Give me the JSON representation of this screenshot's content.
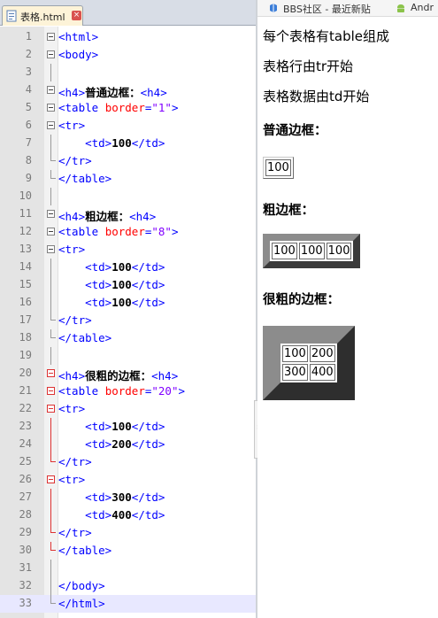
{
  "editor": {
    "tab": {
      "filename": "表格.html",
      "close_glyph": "×"
    },
    "lines": [
      {
        "n": "1",
        "segments": [
          [
            "tag",
            "<html>"
          ]
        ]
      },
      {
        "n": "2",
        "segments": [
          [
            "tag",
            "<body>"
          ]
        ]
      },
      {
        "n": "3",
        "segments": []
      },
      {
        "n": "4",
        "segments": [
          [
            "tag",
            "<h4>"
          ],
          [
            "txt",
            "普通边框："
          ],
          [
            "tag",
            "<h4>"
          ]
        ]
      },
      {
        "n": "5",
        "segments": [
          [
            "tag",
            "<table "
          ],
          [
            "attr",
            "border"
          ],
          [
            "tag",
            "="
          ],
          [
            "str",
            "\"1\""
          ],
          [
            "tag",
            ">"
          ]
        ]
      },
      {
        "n": "6",
        "segments": [
          [
            "tag",
            "<tr>"
          ]
        ]
      },
      {
        "n": "7",
        "segments": [
          [
            "sp",
            "    "
          ],
          [
            "tag",
            "<td>"
          ],
          [
            "txt",
            "100"
          ],
          [
            "tag",
            "</td>"
          ]
        ]
      },
      {
        "n": "8",
        "segments": [
          [
            "tag",
            "</tr>"
          ]
        ]
      },
      {
        "n": "9",
        "segments": [
          [
            "tag",
            "</table>"
          ]
        ]
      },
      {
        "n": "10",
        "segments": []
      },
      {
        "n": "11",
        "segments": [
          [
            "tag",
            "<h4>"
          ],
          [
            "txt",
            "粗边框："
          ],
          [
            "tag",
            "<h4>"
          ]
        ]
      },
      {
        "n": "12",
        "segments": [
          [
            "tag",
            "<table "
          ],
          [
            "attr",
            "border"
          ],
          [
            "tag",
            "="
          ],
          [
            "str",
            "\"8\""
          ],
          [
            "tag",
            ">"
          ]
        ]
      },
      {
        "n": "13",
        "segments": [
          [
            "tag",
            "<tr>"
          ]
        ]
      },
      {
        "n": "14",
        "segments": [
          [
            "sp",
            "    "
          ],
          [
            "tag",
            "<td>"
          ],
          [
            "txt",
            "100"
          ],
          [
            "tag",
            "</td>"
          ]
        ]
      },
      {
        "n": "15",
        "segments": [
          [
            "sp",
            "    "
          ],
          [
            "tag",
            "<td>"
          ],
          [
            "txt",
            "100"
          ],
          [
            "tag",
            "</td>"
          ]
        ]
      },
      {
        "n": "16",
        "segments": [
          [
            "sp",
            "    "
          ],
          [
            "tag",
            "<td>"
          ],
          [
            "txt",
            "100"
          ],
          [
            "tag",
            "</td>"
          ]
        ]
      },
      {
        "n": "17",
        "segments": [
          [
            "tag",
            "</tr>"
          ]
        ]
      },
      {
        "n": "18",
        "segments": [
          [
            "tag",
            "</table>"
          ]
        ]
      },
      {
        "n": "19",
        "segments": []
      },
      {
        "n": "20",
        "segments": [
          [
            "tag",
            "<h4>"
          ],
          [
            "txt",
            "很粗的边框："
          ],
          [
            "tag",
            "<h4>"
          ]
        ]
      },
      {
        "n": "21",
        "segments": [
          [
            "tag",
            "<table "
          ],
          [
            "attr",
            "border"
          ],
          [
            "tag",
            "="
          ],
          [
            "str",
            "\"20\""
          ],
          [
            "tag",
            ">"
          ]
        ]
      },
      {
        "n": "22",
        "segments": [
          [
            "tag",
            "<tr>"
          ]
        ]
      },
      {
        "n": "23",
        "segments": [
          [
            "sp",
            "    "
          ],
          [
            "tag",
            "<td>"
          ],
          [
            "txt",
            "100"
          ],
          [
            "tag",
            "</td>"
          ]
        ]
      },
      {
        "n": "24",
        "segments": [
          [
            "sp",
            "    "
          ],
          [
            "tag",
            "<td>"
          ],
          [
            "txt",
            "200"
          ],
          [
            "tag",
            "</td>"
          ]
        ]
      },
      {
        "n": "25",
        "segments": [
          [
            "tag",
            "</tr>"
          ]
        ]
      },
      {
        "n": "26",
        "segments": [
          [
            "tag",
            "<tr>"
          ]
        ]
      },
      {
        "n": "27",
        "segments": [
          [
            "sp",
            "    "
          ],
          [
            "tag",
            "<td>"
          ],
          [
            "txt",
            "300"
          ],
          [
            "tag",
            "</td>"
          ]
        ]
      },
      {
        "n": "28",
        "segments": [
          [
            "sp",
            "    "
          ],
          [
            "tag",
            "<td>"
          ],
          [
            "txt",
            "400"
          ],
          [
            "tag",
            "</td>"
          ]
        ]
      },
      {
        "n": "29",
        "segments": [
          [
            "tag",
            "</tr>"
          ]
        ]
      },
      {
        "n": "30",
        "segments": [
          [
            "tag",
            "</table>"
          ]
        ]
      },
      {
        "n": "31",
        "segments": []
      },
      {
        "n": "32",
        "segments": [
          [
            "tag",
            "</body>"
          ]
        ]
      },
      {
        "n": "33",
        "segments": [
          [
            "tag",
            "</html>"
          ]
        ]
      }
    ],
    "current_line": "33",
    "colors": {
      "tag": "#0000ff",
      "attr": "#ff0000",
      "string": "#8000ff",
      "fold_marker_active": "#dd3333"
    }
  },
  "browser": {
    "bookmarks": [
      {
        "label": "BBS社区 - 最近新贴",
        "icon": "bbs-icon"
      },
      {
        "label": "Andr",
        "icon": "android-icon"
      }
    ],
    "content": {
      "paragraphs": [
        "每个表格有table组成",
        "表格行由tr开始",
        "表格数据由td开始"
      ],
      "headings": [
        "普通边框：",
        "粗边框：",
        "很粗的边框："
      ],
      "table1": {
        "rows": [
          [
            "100"
          ]
        ]
      },
      "table2": {
        "rows": [
          [
            "100",
            "100",
            "100"
          ]
        ]
      },
      "table3": {
        "rows": [
          [
            "100",
            "200"
          ],
          [
            "300",
            "400"
          ]
        ]
      }
    }
  }
}
